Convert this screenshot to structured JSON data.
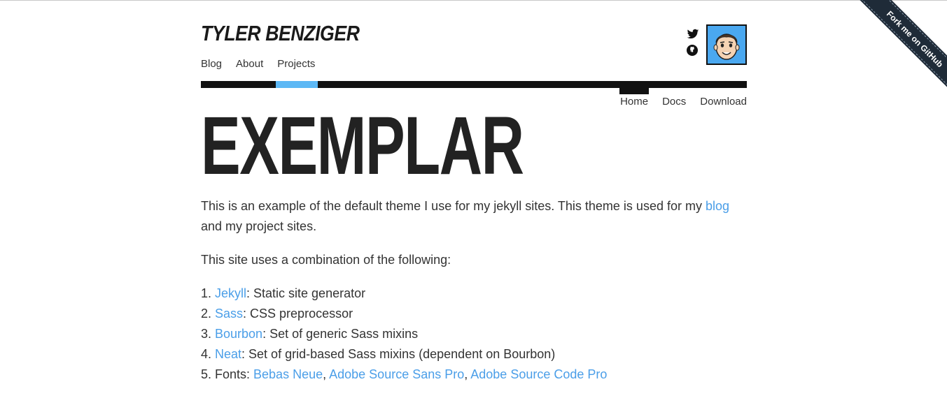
{
  "site": {
    "title": "TYLER BENZIGER"
  },
  "main_nav": {
    "items": [
      {
        "label": "Blog"
      },
      {
        "label": "About"
      },
      {
        "label": "Projects"
      }
    ]
  },
  "social": {
    "icons": [
      "twitter-icon",
      "github-icon"
    ]
  },
  "colors": {
    "accent": "#5cb8f5",
    "link": "#4a9ee8",
    "bar": "#111111",
    "avatar_bg": "#4aa8f0"
  },
  "sub_nav": {
    "items": [
      {
        "label": "Home"
      },
      {
        "label": "Docs"
      },
      {
        "label": "Download"
      }
    ],
    "active": "Home"
  },
  "page": {
    "title": "EXEMPLAR",
    "intro_1": "This is an example of the default theme I use for my jekyll sites. This theme is used for my ",
    "intro_link": "blog",
    "intro_2": " and my project sites.",
    "combo_text": "This site uses a combination of the following:",
    "list": [
      {
        "link": "Jekyll",
        "text": ": Static site generator"
      },
      {
        "link": "Sass",
        "text": ": CSS preprocessor"
      },
      {
        "link": "Bourbon",
        "text": ": Set of generic Sass mixins"
      },
      {
        "link": "Neat",
        "text": ": Set of grid-based Sass mixins (dependent on Bourbon)"
      }
    ],
    "fonts_label": "Fonts: ",
    "fonts": [
      "Bebas Neue",
      "Adobe Source Sans Pro",
      "Adobe Source Code Pro"
    ],
    "fonts_sep": ", "
  },
  "ribbon": {
    "label": "Fork me on GitHub"
  }
}
